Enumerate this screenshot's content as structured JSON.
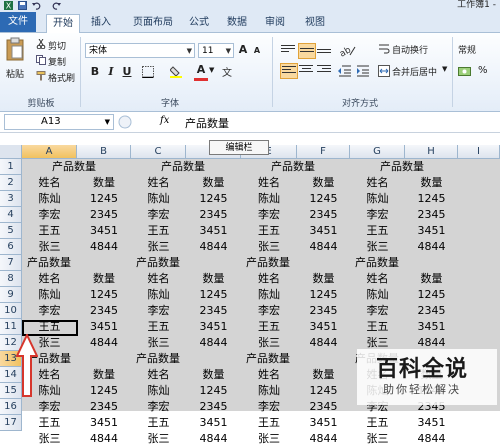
{
  "window": {
    "title": "工作簿1 -"
  },
  "ribbon": {
    "tabs": [
      {
        "label": "文件",
        "kind": "file"
      },
      {
        "label": "开始",
        "kind": "active"
      },
      {
        "label": "插入",
        "kind": ""
      },
      {
        "label": "页面布局",
        "kind": ""
      },
      {
        "label": "公式",
        "kind": ""
      },
      {
        "label": "数据",
        "kind": ""
      },
      {
        "label": "审阅",
        "kind": ""
      },
      {
        "label": "视图",
        "kind": ""
      }
    ],
    "clipboard": {
      "paste": "粘贴",
      "cut": "剪切",
      "copy": "复制",
      "format_painter": "格式刷",
      "group": "剪贴板"
    },
    "font": {
      "name": "宋体",
      "size": "11",
      "bold": "B",
      "italic": "I",
      "underline": "U",
      "font_color_glyph": "A",
      "grow_glyph": "A",
      "shrink_glyph": "A",
      "group": "字体"
    },
    "alignment": {
      "wrap": "自动换行",
      "merge": "合并后居中",
      "group": "对齐方式"
    },
    "number": {
      "format": "常规"
    }
  },
  "formula_bar": {
    "name_box": "A13",
    "fx": "fx",
    "content": "产品数量"
  },
  "tooltip": "编辑栏",
  "columns": [
    "A",
    "B",
    "C",
    "D",
    "E",
    "F",
    "G",
    "H",
    "I"
  ],
  "rows": [
    "1",
    "2",
    "3",
    "4",
    "5",
    "6",
    "7",
    "8",
    "9",
    "10",
    "11",
    "12",
    "13",
    "14",
    "15",
    "16",
    "17"
  ],
  "selected": {
    "column": "A",
    "row": "13"
  },
  "blocks": {
    "title": "产品数量",
    "header": [
      "姓名",
      "数量"
    ],
    "entries": [
      [
        "陈灿",
        "1245"
      ],
      [
        "李宏",
        "2345"
      ],
      [
        "王五",
        "3451"
      ],
      [
        "张三",
        "4844"
      ]
    ]
  },
  "watermark": {
    "title": "百科全说",
    "subtitle": "助你轻松解决"
  }
}
